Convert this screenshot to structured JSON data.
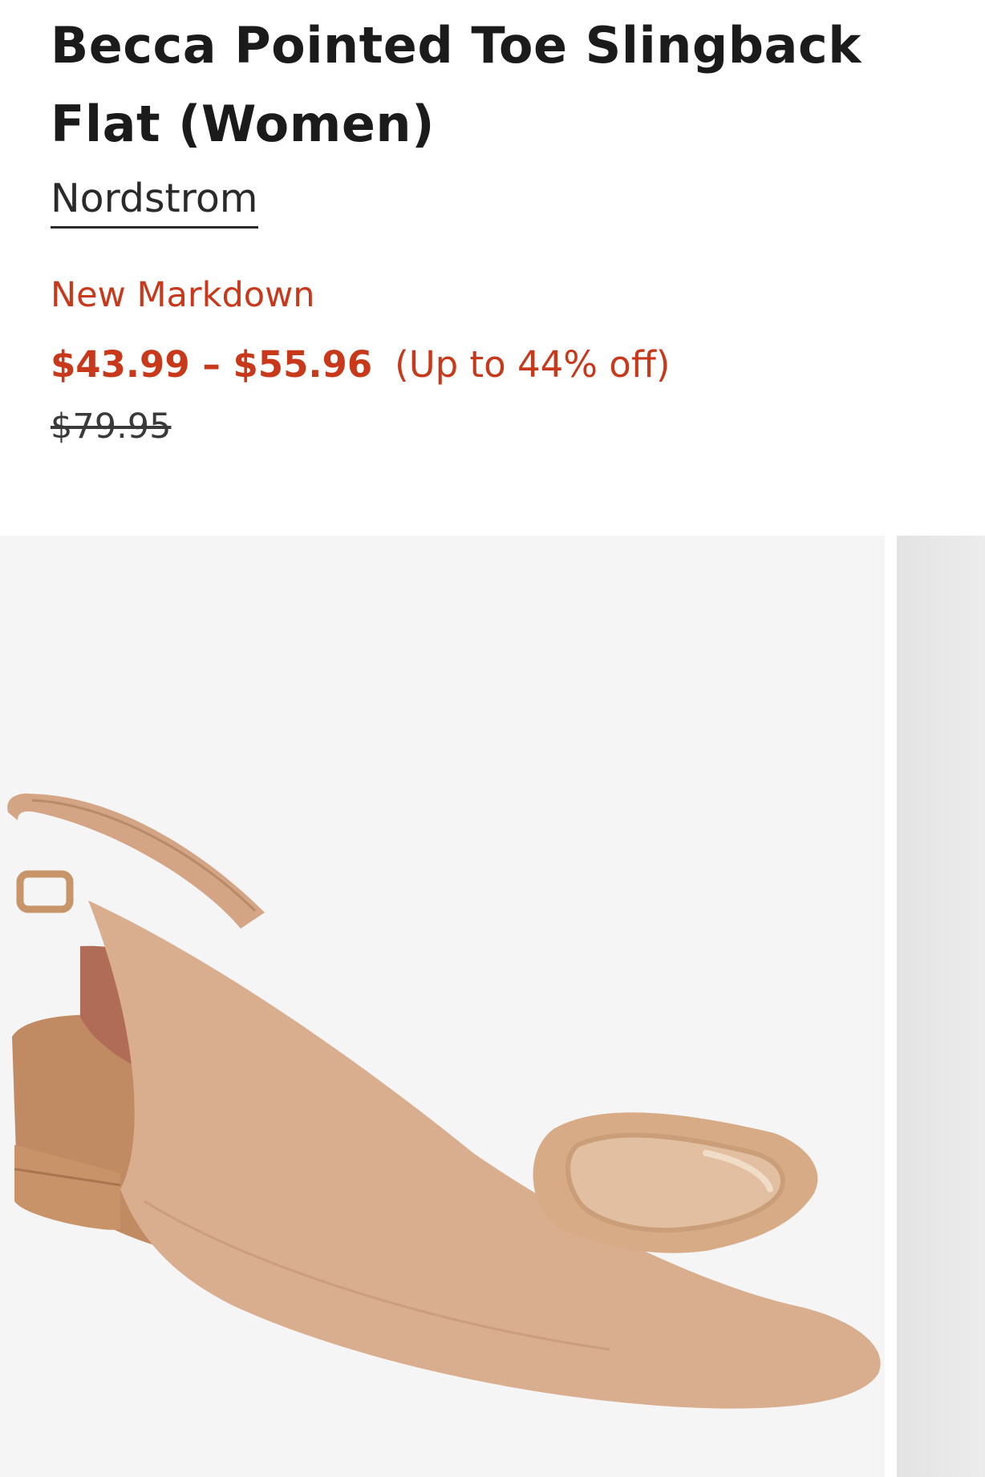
{
  "product": {
    "title": "Becca Pointed Toe Slingback Flat (Women)",
    "brand": "Nordstrom",
    "markdown_label": "New Markdown",
    "price_range": "$43.99 – $55.96",
    "discount": "(Up to 44% off)",
    "original_price": "$79.95"
  },
  "gallery": {
    "main_image_alt": "Becca Pointed Toe Slingback Flat",
    "colors": {
      "background": "#f5f5f5",
      "shoe_upper": "#d9ae8e",
      "shoe_lining": "#b06c57",
      "shoe_sole": "#c08a62"
    }
  },
  "colors": {
    "sale": "#c8391b",
    "text": "#1b1b1b"
  }
}
